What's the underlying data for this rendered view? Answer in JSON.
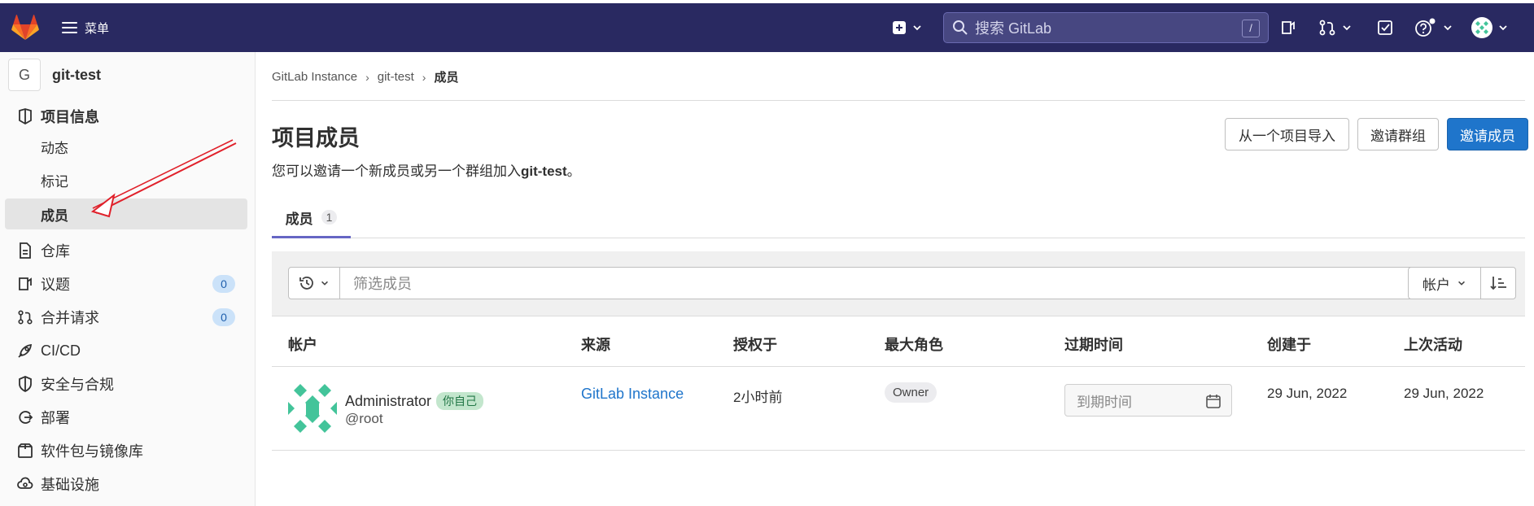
{
  "topbar": {
    "menu_label": "菜单",
    "search_placeholder": "搜索 GitLab",
    "search_shortcut": "/"
  },
  "sidebar": {
    "project_initial": "G",
    "project_name": "git-test",
    "items": [
      {
        "label": "项目信息",
        "icon": "info-icon"
      },
      {
        "label": "动态"
      },
      {
        "label": "标记"
      },
      {
        "label": "成员"
      },
      {
        "label": "仓库",
        "icon": "document-icon"
      },
      {
        "label": "议题",
        "icon": "issues-icon",
        "count": "0"
      },
      {
        "label": "合并请求",
        "icon": "merge-request-icon",
        "count": "0"
      },
      {
        "label": "CI/CD",
        "icon": "rocket-icon"
      },
      {
        "label": "安全与合规",
        "icon": "shield-icon"
      },
      {
        "label": "部署",
        "icon": "deployments-icon"
      },
      {
        "label": "软件包与镜像库",
        "icon": "package-icon"
      },
      {
        "label": "基础设施",
        "icon": "cloud-gear-icon"
      }
    ]
  },
  "breadcrumb": [
    "GitLab Instance",
    "git-test",
    "成员"
  ],
  "page": {
    "title": "项目成员",
    "desc_prefix": "您可以邀请一个新成员或另一个群组加入",
    "desc_project": "git-test",
    "desc_suffix": "。",
    "btn_import": "从一个项目导入",
    "btn_invite_group": "邀请群组",
    "btn_invite_member": "邀请成员"
  },
  "tabs": [
    {
      "label": "成员",
      "count": "1"
    }
  ],
  "filter": {
    "placeholder": "筛选成员",
    "sort_label": "帐户"
  },
  "table": {
    "headers": [
      "帐户",
      "来源",
      "授权于",
      "最大角色",
      "过期时间",
      "创建于",
      "上次活动"
    ],
    "rows": [
      {
        "name": "Administrator",
        "you_badge": "你自己",
        "username": "@root",
        "source": "GitLab Instance",
        "granted": "2小时前",
        "role": "Owner",
        "expires_placeholder": "到期时间",
        "created": "29 Jun, 2022",
        "last_activity": "29 Jun, 2022"
      }
    ]
  },
  "colors": {
    "topbar": "#292961",
    "primary": "#1f75cb",
    "tab_underline": "#6666c4",
    "annotation_arrow": "#e0202a"
  }
}
